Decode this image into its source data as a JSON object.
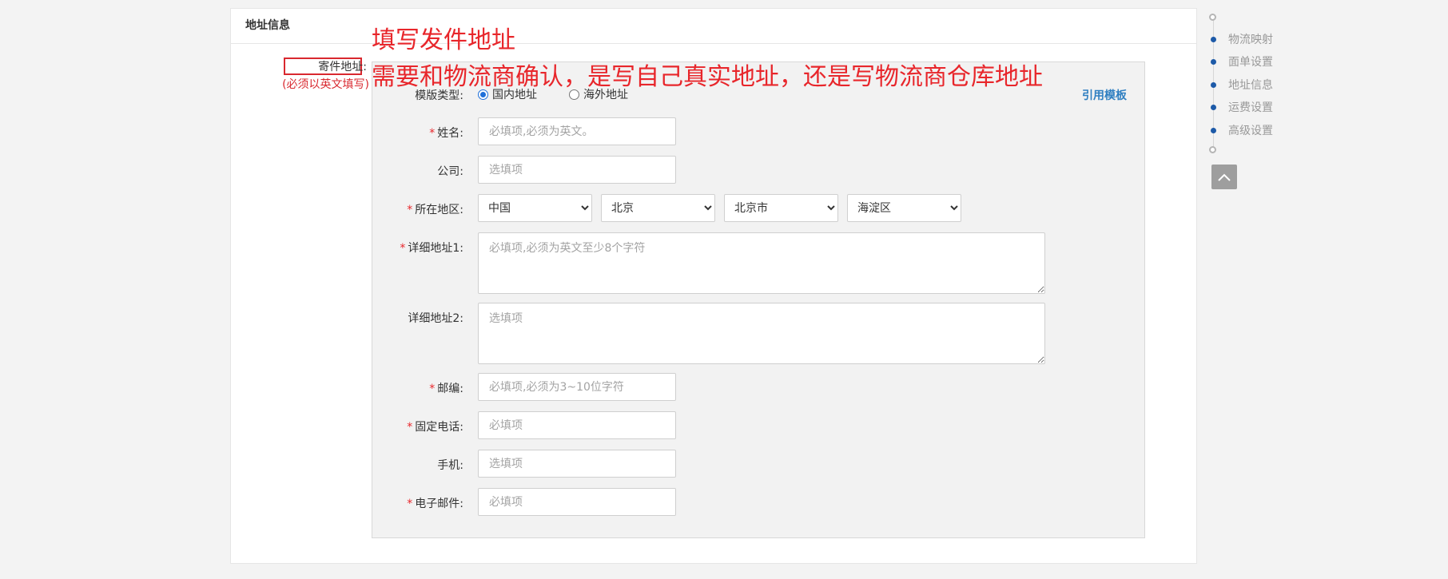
{
  "section": {
    "title": "地址信息",
    "sender_label": "寄件地址:",
    "sender_note": "(必须以英文填写)"
  },
  "annotations": {
    "line1": "填写发件地址",
    "line2": "需要和物流商确认，是写自己真实地址，还是写物流商仓库地址"
  },
  "form": {
    "template_type_label": "模版类型:",
    "template_options": [
      "国内地址",
      "海外地址"
    ],
    "template_selected": "国内地址",
    "use_template_link": "引用模板",
    "name": {
      "label": "姓名:",
      "placeholder": "必填项,必须为英文。"
    },
    "company": {
      "label": "公司:",
      "placeholder": "选填项"
    },
    "region": {
      "label": "所在地区:",
      "country": "中国",
      "province": "北京",
      "city": "北京市",
      "district": "海淀区"
    },
    "address1": {
      "label": "详细地址1:",
      "placeholder": "必填项,必须为英文至少8个字符"
    },
    "address2": {
      "label": "详细地址2:",
      "placeholder": "选填项"
    },
    "postcode": {
      "label": "邮编:",
      "placeholder": "必填项,必须为3~10位字符"
    },
    "phone": {
      "label": "固定电话:",
      "placeholder": "必填项"
    },
    "mobile": {
      "label": "手机:",
      "placeholder": "选填项"
    },
    "email": {
      "label": "电子邮件:",
      "placeholder": "必填项"
    },
    "required_mark": "*"
  },
  "nav": {
    "items": [
      "物流映射",
      "面单设置",
      "地址信息",
      "运费设置",
      "高级设置"
    ],
    "top_icon": "chevron-up-icon"
  },
  "colors": {
    "accent_red": "#e8262b",
    "link_blue": "#2f7fc1",
    "nav_dot": "#1d5aa8"
  }
}
